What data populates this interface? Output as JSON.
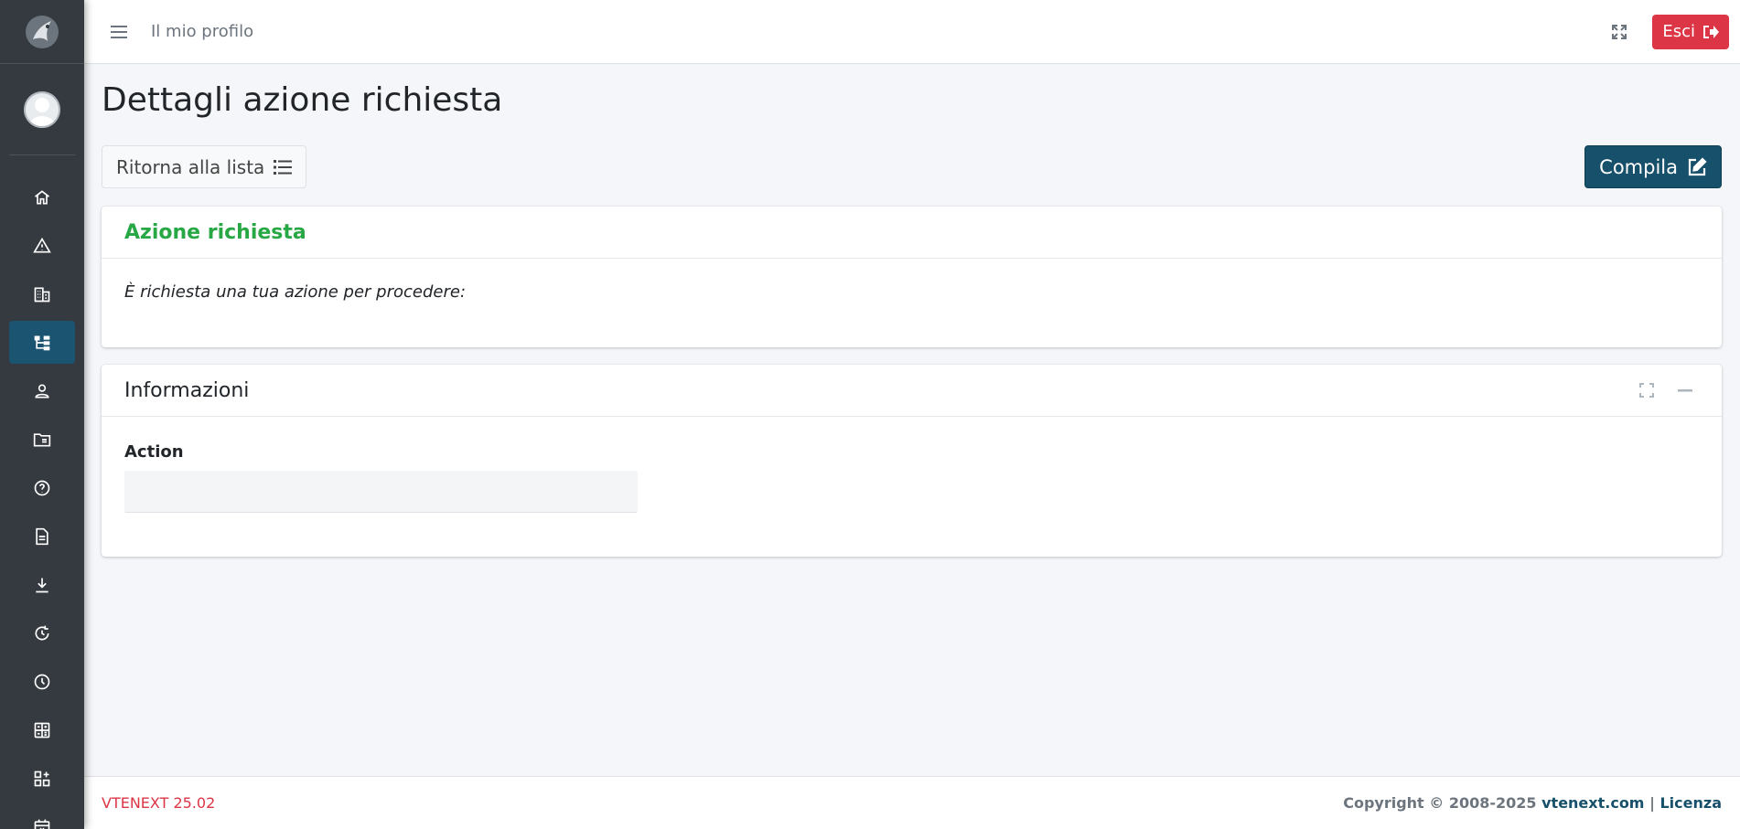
{
  "sidebar": {
    "items": [
      {
        "icon": "home-icon",
        "name": "sidebar-item-home",
        "active": false
      },
      {
        "icon": "warning-icon",
        "name": "sidebar-item-alerts",
        "active": false
      },
      {
        "icon": "building-icon",
        "name": "sidebar-item-companies",
        "active": false
      },
      {
        "icon": "sitemap-icon",
        "name": "sidebar-item-processes",
        "active": true
      },
      {
        "icon": "user-icon",
        "name": "sidebar-item-contacts",
        "active": false
      },
      {
        "icon": "folder-icon",
        "name": "sidebar-item-documents-folder",
        "active": false
      },
      {
        "icon": "help-icon",
        "name": "sidebar-item-help",
        "active": false
      },
      {
        "icon": "document-icon",
        "name": "sidebar-item-documents",
        "active": false
      },
      {
        "icon": "download-icon",
        "name": "sidebar-item-downloads",
        "active": false
      },
      {
        "icon": "refresh-icon",
        "name": "sidebar-item-renewals",
        "active": false
      },
      {
        "icon": "clock-icon",
        "name": "sidebar-item-timecards",
        "active": false
      },
      {
        "icon": "calculator-icon",
        "name": "sidebar-item-quotes",
        "active": false
      },
      {
        "icon": "apps-icon",
        "name": "sidebar-item-services",
        "active": false
      },
      {
        "icon": "calendar-x-icon",
        "name": "sidebar-item-calendar",
        "active": false
      }
    ]
  },
  "topbar": {
    "profile_link": "Il mio profilo",
    "logout_label": "Esci"
  },
  "page": {
    "title": "Dettagli azione richiesta",
    "back_label": "Ritorna alla lista",
    "fill_label": "Compila"
  },
  "card_action": {
    "title": "Azione richiesta",
    "message": "È richiesta una tua azione per procedere:"
  },
  "card_info": {
    "title": "Informazioni",
    "field_label": "Action",
    "field_value": ""
  },
  "footer": {
    "version": "VTENEXT 25.02",
    "copyright": "Copyright © 2008-2025",
    "site_link": "vtenext.com",
    "separator": "|",
    "license_link": "Licenza"
  },
  "colors": {
    "sidebar_bg": "#343a40",
    "active_item": "#1b5470",
    "primary": "#17506b",
    "danger": "#dc3545",
    "success": "#28a745"
  }
}
